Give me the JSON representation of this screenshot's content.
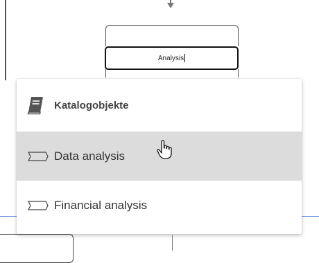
{
  "shape": {
    "edit_value": "Analysis"
  },
  "dropdown": {
    "header": {
      "label": "Katalogobjekte",
      "icon": "book-icon"
    },
    "items": [
      {
        "label": "Data analysis",
        "icon": "function-shape-icon",
        "highlighted": true
      },
      {
        "label": "Financial analysis",
        "icon": "function-shape-icon",
        "highlighted": false
      }
    ]
  },
  "colors": {
    "highlight": "#dcdcdc",
    "connector_blue": "#4a7fd4",
    "text": "#333333"
  }
}
